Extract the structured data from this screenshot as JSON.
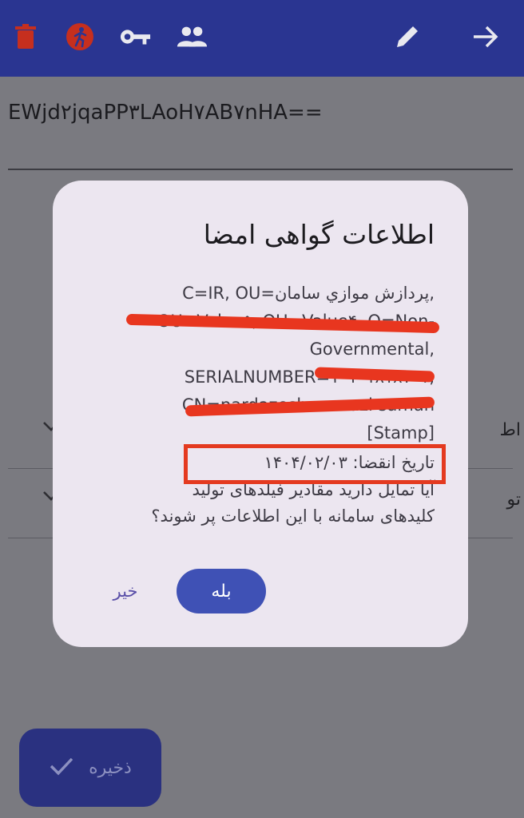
{
  "appbar": {
    "icons": [
      "trash-icon",
      "exit-run-icon",
      "key-icon",
      "people-icon",
      "pencil-icon",
      "arrow-forward-icon"
    ]
  },
  "content": {
    "field_value": "EWjd۲jqaPP۳LAoH۷AB۷nHA==",
    "rows": [
      {
        "label": "اط"
      },
      {
        "label": "تو"
      }
    ]
  },
  "dialog": {
    "title": "اطلاعات گواهی امضا",
    "subject_lines": [
      "C=IR, OU=پردازش موازي سامان,",
      "OU=Value۵, OU=Value۴, O=Non-",
      "Governmental,",
      "SERIALNUMBER=۱۰۱۰۱۸۱۸۷۰۱,",
      "CN=pardazesh movazi saman",
      "[Stamp]"
    ],
    "expiry": "تاریخ انقضا: ۱۴۰۴/۰۲/۰۳",
    "question": "آیا تمایل دارید مقادیر فیلدهای تولید کلیدهای سامانه با این اطلاعات پر شوند؟",
    "yes_label": "بله",
    "no_label": "خیر"
  },
  "fab": {
    "label": "ذخیره"
  },
  "colors": {
    "appbar": "#2a3591",
    "accent": "#3f51b5",
    "dialog_bg": "#ece6f0",
    "annotation_red": "#e43a20"
  }
}
